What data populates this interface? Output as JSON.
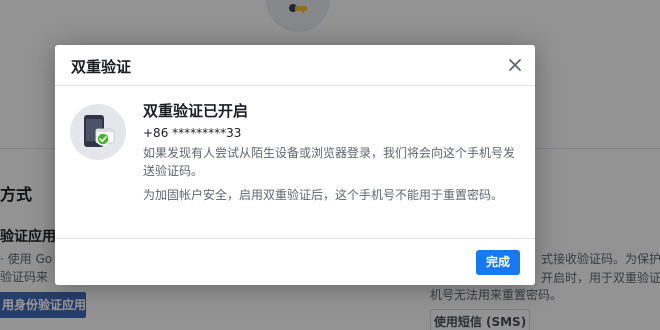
{
  "background": {
    "left_heading": "方式",
    "left_subheading": "验证应用",
    "left_desc_line1": "· 使用 Go",
    "left_desc_line2": "验证码来",
    "left_button": "用身份验证应用",
    "right_desc_line1": "式接收验证码。为保护",
    "right_desc_line2": "开启时，用于双重验证",
    "right_desc_line3": "机号无法用来重置密码。",
    "right_button": "使用短信 (SMS)"
  },
  "modal": {
    "title": "双重验证",
    "content_title": "双重验证已开启",
    "phone": "+86 *********33",
    "desc1": "如果发现有人尝试从陌生设备或浏览器登录，我们将会向这个手机号发送验证码。",
    "desc2": "为加固帐户安全，启用双重验证后，这个手机号不能用于重置密码。",
    "done_button": "完成"
  },
  "colors": {
    "primary_button": "#1877f2",
    "success_check": "#42b72a"
  },
  "icons": {
    "close": "close-icon",
    "illustration": "phone-check-icon",
    "key": "key-icon"
  }
}
